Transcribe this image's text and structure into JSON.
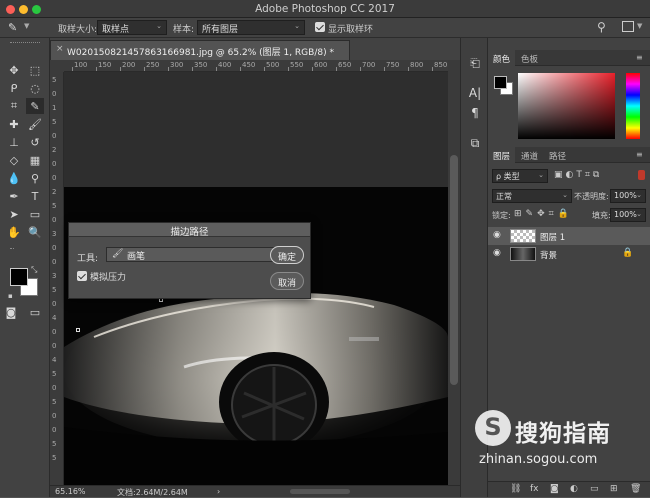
{
  "app": {
    "title": "Adobe Photoshop CC 2017"
  },
  "options_bar": {
    "sample_size_label": "取样大小:",
    "sample_size_value": "取样点",
    "sample_label": "样本:",
    "sample_value": "所有图层",
    "show_ring_label": "显示取样环"
  },
  "document": {
    "tab_title": "W020150821457863166981.jpg @ 65.2% (图层 1, RGB/8) *",
    "close_glyph": "×"
  },
  "ruler_top_ticks": [
    "100",
    "150",
    "200",
    "250",
    "300",
    "350",
    "400",
    "450",
    "500",
    "550",
    "600",
    "650",
    "700",
    "750",
    "800",
    "850"
  ],
  "ruler_left_ticks": [
    "5",
    "0",
    "1",
    "5",
    "0",
    "2",
    "0",
    "0",
    "2",
    "5",
    "0",
    "3",
    "0",
    "0",
    "3",
    "5",
    "0",
    "4",
    "0",
    "0",
    "4",
    "5",
    "0",
    "5",
    "0",
    "0",
    "5",
    "5"
  ],
  "status": {
    "zoom": "65.16%",
    "doc_info": "文档:2.64M/2.64M",
    "arrow": "›"
  },
  "dialog": {
    "title": "描边路径",
    "tool_label": "工具:",
    "tool_value": "画笔",
    "simulate_pressure": "模拟压力",
    "ok": "确定",
    "cancel": "取消"
  },
  "color_panel": {
    "tabs": [
      "颜色",
      "色板"
    ],
    "fg": "#000000",
    "bg": "#ffffff"
  },
  "layers_panel": {
    "tabs": [
      "图层",
      "通道",
      "路径"
    ],
    "filter_kind": "ρ 类型",
    "blend_mode": "正常",
    "opacity_label": "不透明度:",
    "opacity_value": "100%",
    "lock_label": "锁定:",
    "fill_label": "填充:",
    "fill_value": "100%",
    "layers": [
      {
        "name": "图层 1",
        "selected": true
      },
      {
        "name": "背景",
        "locked": true
      }
    ]
  },
  "watermark": {
    "cn": "搜狗指南",
    "en": "zhinan.sogou.com",
    "logo": "S"
  }
}
